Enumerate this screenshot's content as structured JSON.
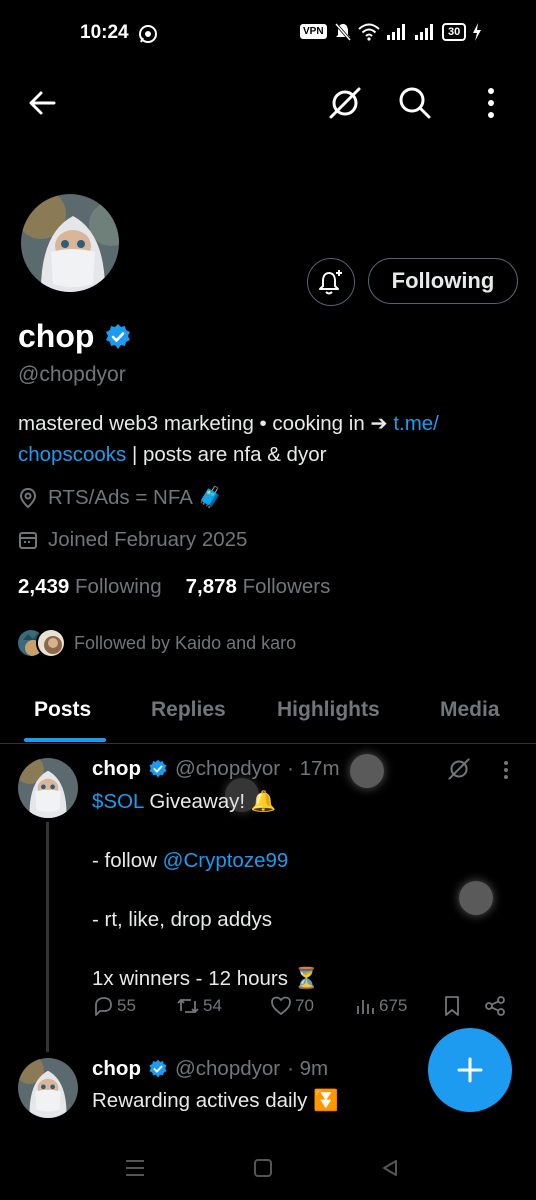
{
  "status_bar": {
    "time": "10:24",
    "vpn": "VPN",
    "battery": "30"
  },
  "profile": {
    "name": "chop",
    "handle": "@chopdyor",
    "bio_text": "mastered web3 marketing • cooking in ➔ ",
    "bio_link1": "t.me/",
    "bio_link2": "chopscooks",
    "bio_tail": " | posts are nfa & dyor",
    "location": "RTS/Ads = NFA 🧳",
    "joined": "Joined February 2025",
    "following_count": "2,439",
    "following_label": "Following",
    "followers_count": "7,878",
    "followers_label": "Followers",
    "followed_by": "Followed by Kaido and karo",
    "follow_button": "Following"
  },
  "tabs": [
    "Posts",
    "Replies",
    "Highlights",
    "Media"
  ],
  "tweets": [
    {
      "name": "chop",
      "handle": "@chopdyor",
      "time": "· 17m",
      "cashtag": "$SOL",
      "line1_rest": " Giveaway! 🔔",
      "line2_pre": "- follow ",
      "line2_mention": "@Cryptoze99",
      "line3": "- rt, like, drop addys",
      "line4": "1x winners - 12 hours ⏳",
      "replies": "55",
      "reposts": "54",
      "likes": "70",
      "views": "675"
    },
    {
      "name": "chop",
      "handle": "@chopdyor",
      "time": "· 9m",
      "text": "Rewarding actives daily ⏬"
    }
  ],
  "colors": {
    "accent": "#1d9bf0",
    "background": "#000000",
    "muted": "#71767b"
  }
}
